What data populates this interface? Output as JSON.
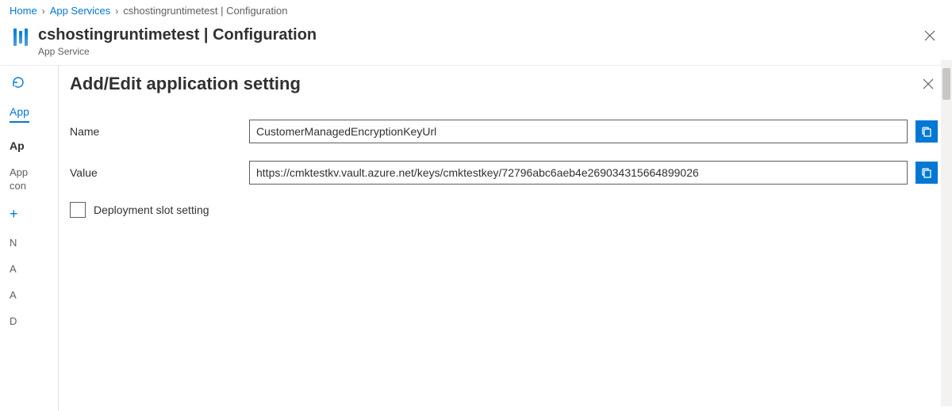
{
  "breadcrumb": {
    "home": "Home",
    "appServices": "App Services",
    "current": "cshostingruntimetest | Configuration"
  },
  "header": {
    "title": "cshostingruntimetest | Configuration",
    "subtitle": "App Service"
  },
  "sidebar": {
    "tab_active": "App",
    "section": "Ap",
    "subtext1": "App",
    "subtext2": "con",
    "col_n": "N",
    "col_a1": "A",
    "col_a2": "A",
    "col_d": "D"
  },
  "blade": {
    "title": "Add/Edit application setting",
    "nameLabel": "Name",
    "nameValue": "CustomerManagedEncryptionKeyUrl",
    "valueLabel": "Value",
    "valueValue": "https://cmktestkv.vault.azure.net/keys/cmktestkey/72796abc6aeb4e269034315664899026",
    "slotLabel": "Deployment slot setting"
  }
}
